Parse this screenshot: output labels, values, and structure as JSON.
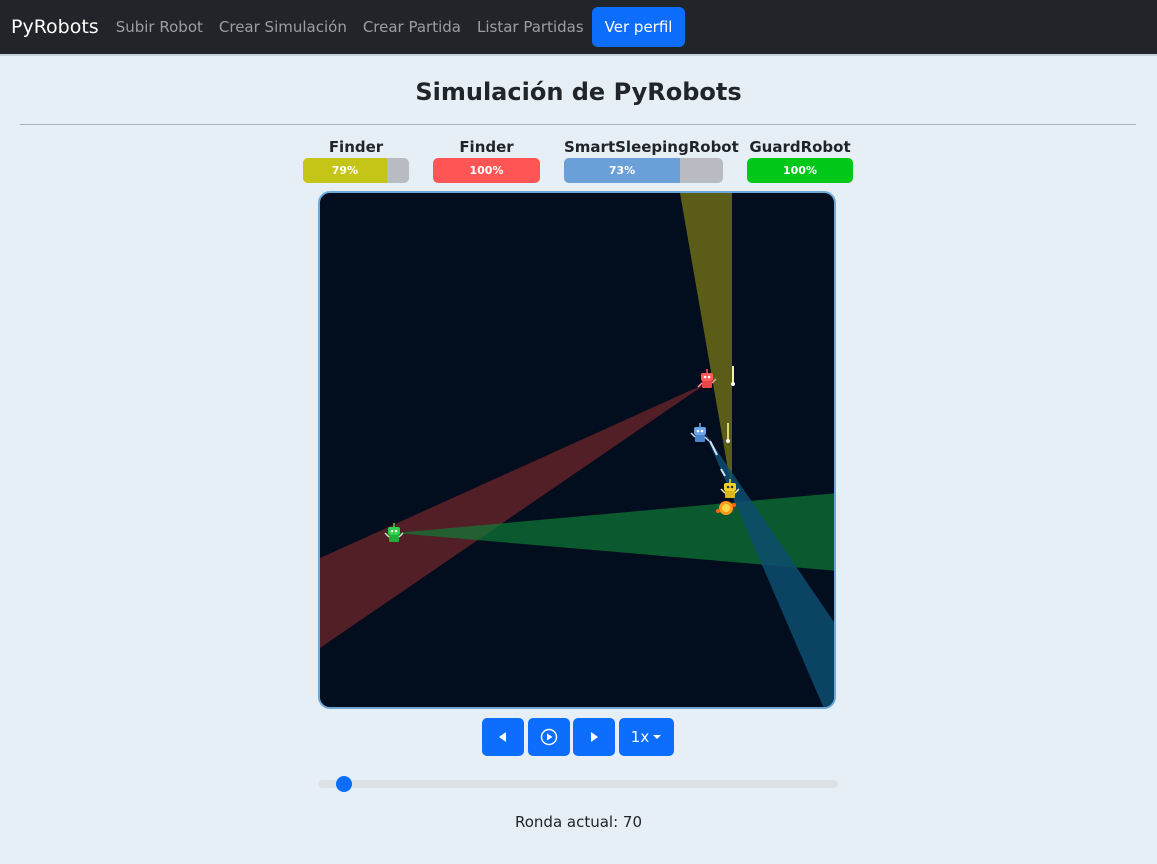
{
  "nav": {
    "brand": "PyRobots",
    "links": [
      "Subir Robot",
      "Crear Simulación",
      "Crear Partida",
      "Listar Partidas"
    ],
    "profile_button": "Ver perfil"
  },
  "page_title": "Simulación de PyRobots",
  "robots": [
    {
      "name": "Finder",
      "health_label": "79%",
      "health": 79,
      "color": "#c5c517"
    },
    {
      "name": "Finder",
      "health_label": "100%",
      "health": 100,
      "color": "#ff5555"
    },
    {
      "name": "SmartSleepingRobot",
      "health_label": "73%",
      "health": 73,
      "color": "#6a9fd8"
    },
    {
      "name": "GuardRobot",
      "health_label": "100%",
      "health": 100,
      "color": "#00c818"
    }
  ],
  "controls": {
    "prev_icon": "step-backward-icon",
    "play_icon": "play-circle-icon",
    "next_icon": "step-forward-icon",
    "speed_label": "1x"
  },
  "round_text": "Ronda actual: 70",
  "colors": {
    "navbar": "#212529",
    "accent": "#0d6efd",
    "board": "#020d1e",
    "page_bg": "#e5eff5"
  }
}
